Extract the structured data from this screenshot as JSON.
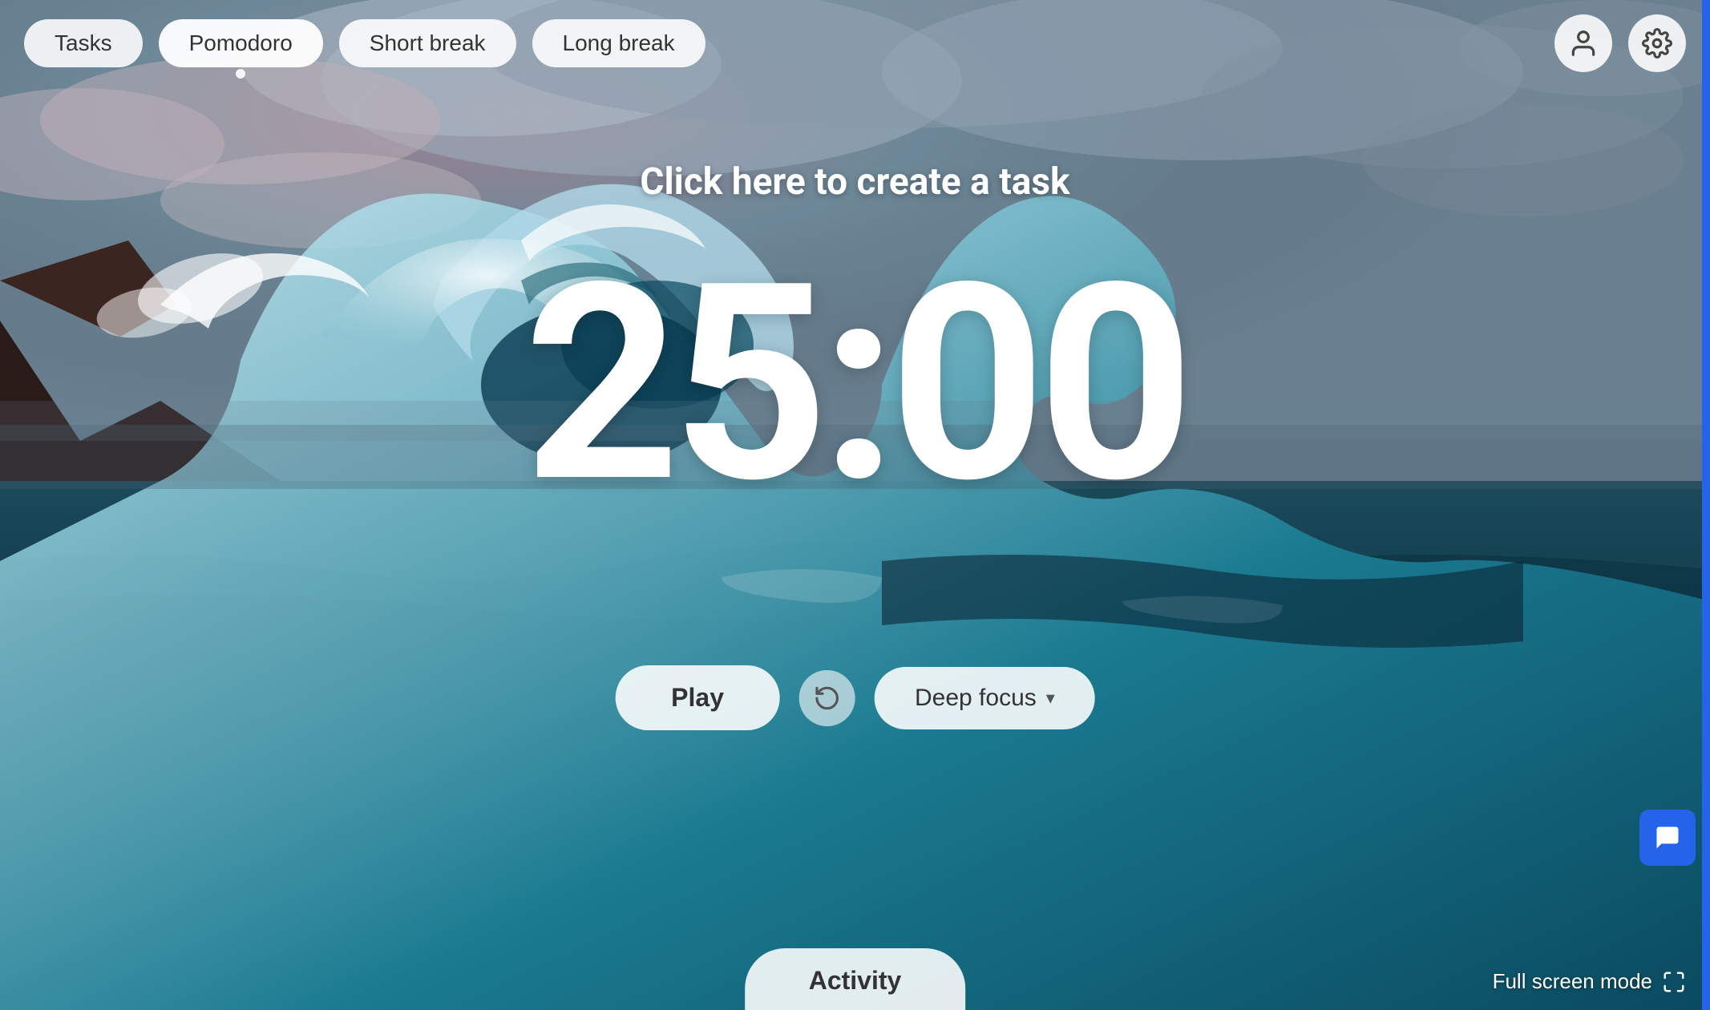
{
  "nav": {
    "tasks_label": "Tasks",
    "pomodoro_label": "Pomodoro",
    "short_break_label": "Short break",
    "long_break_label": "Long break"
  },
  "icons": {
    "user": "person-icon",
    "settings": "gear-icon",
    "chat": "chat-icon",
    "reset": "reset-icon",
    "fullscreen": "fullscreen-icon"
  },
  "main": {
    "task_prompt": "Click here to create a task",
    "timer": "25:00"
  },
  "controls": {
    "play_label": "Play",
    "focus_label": "Deep focus"
  },
  "activity": {
    "label": "Activity"
  },
  "footer": {
    "fullscreen_label": "Full screen mode"
  }
}
